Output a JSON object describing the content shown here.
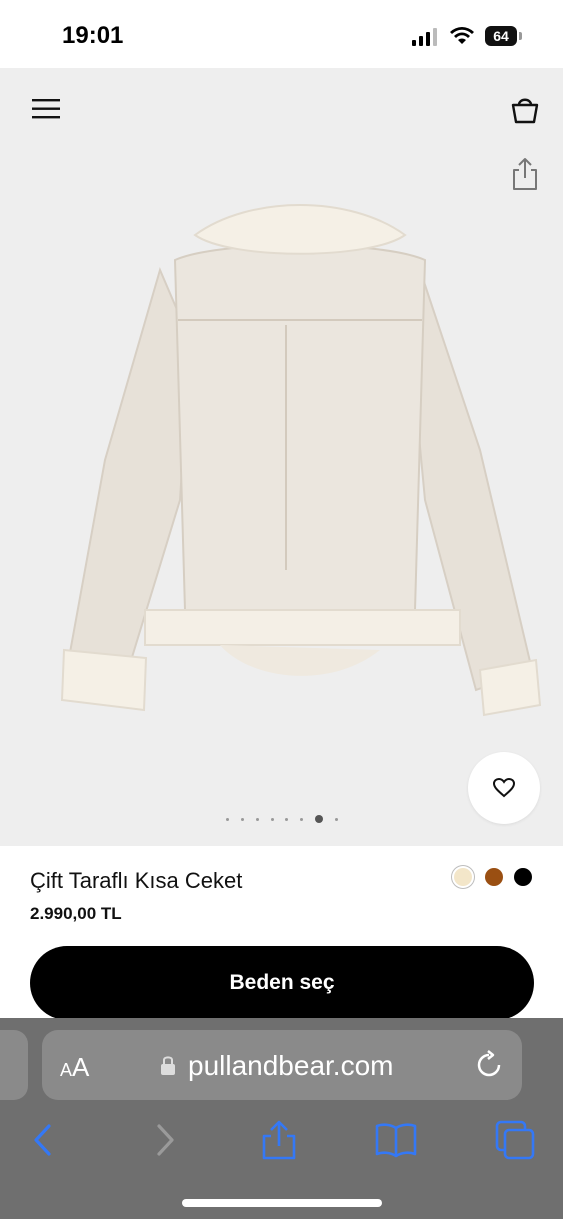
{
  "status": {
    "time": "19:01",
    "battery": "64"
  },
  "header": {
    "menu_icon": "hamburger-menu-icon",
    "cart_icon": "shopping-bag-icon",
    "share_icon": "share-icon"
  },
  "gallery": {
    "image_count": 8,
    "active_index": 6,
    "wishlist_icon": "heart-icon"
  },
  "product": {
    "title": "Çift Taraflı Kısa Ceket",
    "price": "2.990,00 TL",
    "colors": [
      "#f3e6c9",
      "#9a4f12",
      "#000000"
    ],
    "selected_color_index": 0,
    "cta_label": "Beden seç"
  },
  "browser": {
    "aa_small": "A",
    "aa_large": "A",
    "url": "pullandbear.com",
    "toolbar_icons": [
      "back-icon",
      "forward-icon",
      "share-icon",
      "bookmarks-icon",
      "tabs-icon"
    ]
  }
}
